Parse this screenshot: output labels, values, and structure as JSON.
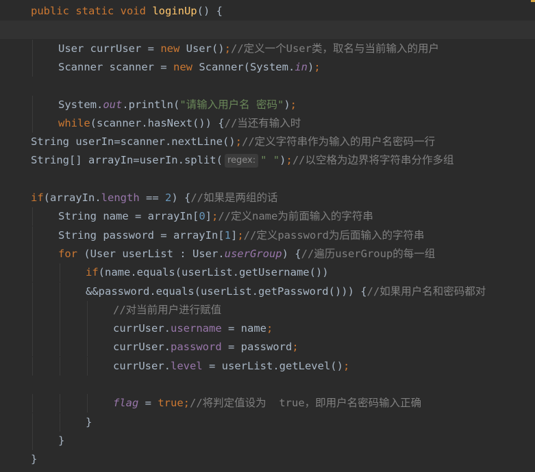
{
  "editor": {
    "lines": [
      {
        "indent": 0,
        "current": false,
        "tokens": [
          {
            "t": "public static void ",
            "c": "kw"
          },
          {
            "t": "loginUp",
            "c": "fn"
          },
          {
            "t": "() {",
            "c": "p"
          }
        ]
      },
      {
        "indent": 0,
        "current": true,
        "tokens": []
      },
      {
        "indent": 1,
        "current": false,
        "tokens": [
          {
            "t": "User currUser = ",
            "c": "p"
          },
          {
            "t": "new ",
            "c": "kw"
          },
          {
            "t": "User()",
            "c": "p"
          },
          {
            "t": ";",
            "c": "kw"
          },
          {
            "t": "//定义一个User类，取名与当前输入的用户",
            "c": "cmt"
          }
        ]
      },
      {
        "indent": 1,
        "current": false,
        "tokens": [
          {
            "t": "Scanner scanner = ",
            "c": "p"
          },
          {
            "t": "new ",
            "c": "kw"
          },
          {
            "t": "Scanner(System.",
            "c": "p"
          },
          {
            "t": "in",
            "c": "fld-i"
          },
          {
            "t": ")",
            "c": "p"
          },
          {
            "t": ";",
            "c": "kw"
          }
        ]
      },
      {
        "indent": 0,
        "current": false,
        "tokens": []
      },
      {
        "indent": 1,
        "current": false,
        "tokens": [
          {
            "t": "System.",
            "c": "p"
          },
          {
            "t": "out",
            "c": "fld-i"
          },
          {
            "t": ".println(",
            "c": "p"
          },
          {
            "t": "\"请输入用户名 密码\"",
            "c": "str"
          },
          {
            "t": ")",
            "c": "p"
          },
          {
            "t": ";",
            "c": "kw"
          }
        ]
      },
      {
        "indent": 1,
        "current": false,
        "tokens": [
          {
            "t": "while",
            "c": "kw"
          },
          {
            "t": "(scanner.hasNext()) {",
            "c": "p"
          },
          {
            "t": "//当还有输入时",
            "c": "cmt"
          }
        ]
      },
      {
        "indent": 0,
        "current": false,
        "tokens": [
          {
            "t": "String userIn=scanner.nextLine()",
            "c": "p"
          },
          {
            "t": ";",
            "c": "kw"
          },
          {
            "t": "//定义字符串作为输入的用户名密码一行",
            "c": "cmt"
          }
        ]
      },
      {
        "indent": 0,
        "current": false,
        "tokens": [
          {
            "t": "String[] arrayIn=userIn.split(",
            "c": "p"
          },
          {
            "t": "regex:",
            "c": "hint"
          },
          {
            "t": "\" \"",
            "c": "str"
          },
          {
            "t": ")",
            "c": "p"
          },
          {
            "t": ";",
            "c": "kw"
          },
          {
            "t": "//以空格为边界将字符串分作多组",
            "c": "cmt"
          }
        ]
      },
      {
        "indent": 0,
        "current": false,
        "tokens": []
      },
      {
        "indent": 0,
        "current": false,
        "tokens": [
          {
            "t": "if",
            "c": "kw"
          },
          {
            "t": "(arrayIn.",
            "c": "p"
          },
          {
            "t": "length",
            "c": "fld"
          },
          {
            "t": " == ",
            "c": "p"
          },
          {
            "t": "2",
            "c": "num"
          },
          {
            "t": ") {",
            "c": "p"
          },
          {
            "t": "//如果是两组的话",
            "c": "cmt"
          }
        ]
      },
      {
        "indent": 1,
        "current": false,
        "tokens": [
          {
            "t": "String name = arrayIn[",
            "c": "p"
          },
          {
            "t": "0",
            "c": "num"
          },
          {
            "t": "]",
            "c": "p"
          },
          {
            "t": ";",
            "c": "kw"
          },
          {
            "t": "//定义name为前面输入的字符串",
            "c": "cmt"
          }
        ]
      },
      {
        "indent": 1,
        "current": false,
        "tokens": [
          {
            "t": "String password = arrayIn[",
            "c": "p"
          },
          {
            "t": "1",
            "c": "num"
          },
          {
            "t": "]",
            "c": "p"
          },
          {
            "t": ";",
            "c": "kw"
          },
          {
            "t": "//定义password为后面输入的字符串",
            "c": "cmt"
          }
        ]
      },
      {
        "indent": 1,
        "current": false,
        "tokens": [
          {
            "t": "for ",
            "c": "kw"
          },
          {
            "t": "(User userList : User.",
            "c": "p"
          },
          {
            "t": "userGroup",
            "c": "fld-i"
          },
          {
            "t": ") {",
            "c": "p"
          },
          {
            "t": "//遍历userGroup的每一组",
            "c": "cmt"
          }
        ]
      },
      {
        "indent": 2,
        "current": false,
        "tokens": [
          {
            "t": "if",
            "c": "kw"
          },
          {
            "t": "(name.equals(userList.getUsername())",
            "c": "p"
          }
        ]
      },
      {
        "indent": 2,
        "current": false,
        "tokens": [
          {
            "t": "&&password.equals(userList.getPassword())) {",
            "c": "p"
          },
          {
            "t": "//如果用户名和密码都对",
            "c": "cmt"
          }
        ]
      },
      {
        "indent": 3,
        "current": false,
        "tokens": [
          {
            "t": "//对当前用户进行赋值",
            "c": "cmt"
          }
        ]
      },
      {
        "indent": 3,
        "current": false,
        "tokens": [
          {
            "t": "currUser.",
            "c": "p"
          },
          {
            "t": "username",
            "c": "fld"
          },
          {
            "t": " = name",
            "c": "p"
          },
          {
            "t": ";",
            "c": "kw"
          }
        ]
      },
      {
        "indent": 3,
        "current": false,
        "tokens": [
          {
            "t": "currUser.",
            "c": "p"
          },
          {
            "t": "password",
            "c": "fld"
          },
          {
            "t": " = password",
            "c": "p"
          },
          {
            "t": ";",
            "c": "kw"
          }
        ]
      },
      {
        "indent": 3,
        "current": false,
        "tokens": [
          {
            "t": "currUser.",
            "c": "p"
          },
          {
            "t": "level",
            "c": "fld"
          },
          {
            "t": " = userList.getLevel()",
            "c": "p"
          },
          {
            "t": ";",
            "c": "kw"
          }
        ]
      },
      {
        "indent": 0,
        "current": false,
        "tokens": []
      },
      {
        "indent": 3,
        "current": false,
        "tokens": [
          {
            "t": "flag",
            "c": "fld-i"
          },
          {
            "t": " = ",
            "c": "p"
          },
          {
            "t": "true",
            "c": "kw"
          },
          {
            "t": ";",
            "c": "kw"
          },
          {
            "t": "//将判定值设为  true，即用户名密码输入正确",
            "c": "cmt"
          }
        ]
      },
      {
        "indent": 2,
        "current": false,
        "tokens": [
          {
            "t": "}",
            "c": "p"
          }
        ]
      },
      {
        "indent": 1,
        "current": false,
        "tokens": [
          {
            "t": "}",
            "c": "p"
          }
        ]
      },
      {
        "indent": 0,
        "current": false,
        "tokens": [
          {
            "t": "}",
            "c": "p"
          }
        ]
      }
    ]
  },
  "theme": {
    "background": "#2b2b2b",
    "current_line": "#323232",
    "default": "#a9b7c6",
    "keyword": "#cc7832",
    "function": "#ffc66d",
    "string": "#6a8759",
    "number": "#6897bb",
    "comment": "#808080",
    "field": "#9876aa"
  }
}
